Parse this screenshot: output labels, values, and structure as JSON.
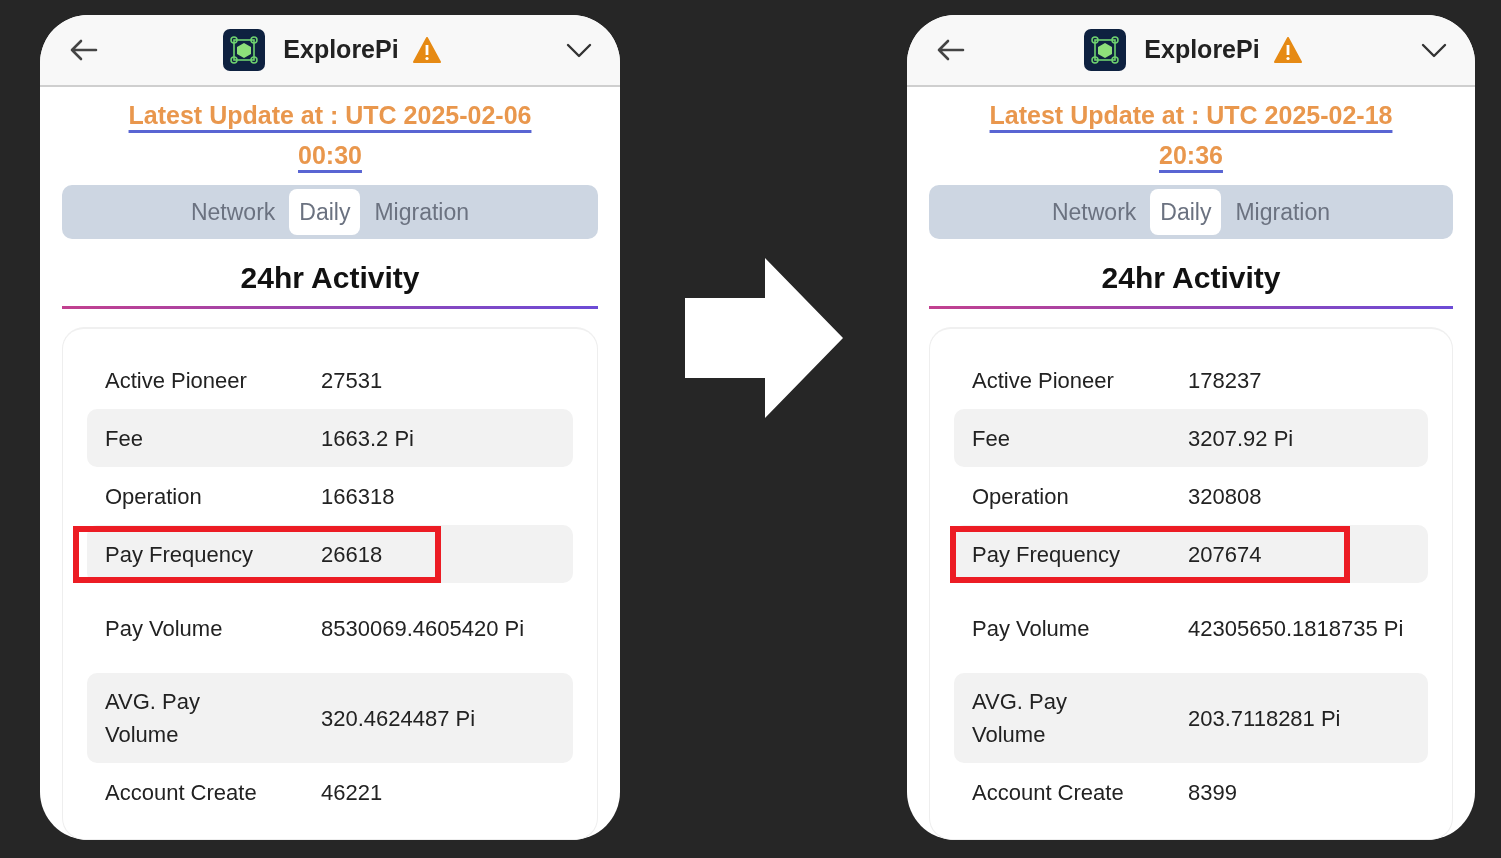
{
  "screens": [
    {
      "app_name": "ExplorePi",
      "update_text": "Latest Update at : UTC 2025-02-06 00:30",
      "tabs": [
        {
          "label": "Network",
          "selected": false
        },
        {
          "label": "Daily",
          "selected": true
        },
        {
          "label": "Migration",
          "selected": false
        }
      ],
      "heading": "24hr Activity",
      "rows": [
        {
          "label": "Active Pioneer",
          "value": "27531",
          "highlighted": false
        },
        {
          "label": "Fee",
          "value": "1663.2 Pi",
          "highlighted": false
        },
        {
          "label": "Operation",
          "value": "166318",
          "highlighted": false
        },
        {
          "label": "Pay Frequency",
          "value": "26618",
          "highlighted": true
        },
        {
          "label": "Pay Volume",
          "value": "8530069.4605420 Pi",
          "highlighted": false
        },
        {
          "label": "AVG. Pay Volume",
          "value": "320.4624487 Pi",
          "highlighted": false
        },
        {
          "label": "Account Create",
          "value": "46221",
          "highlighted": false
        }
      ]
    },
    {
      "app_name": "ExplorePi",
      "update_text": "Latest Update at : UTC 2025-02-18 20:36",
      "tabs": [
        {
          "label": "Network",
          "selected": false
        },
        {
          "label": "Daily",
          "selected": true
        },
        {
          "label": "Migration",
          "selected": false
        }
      ],
      "heading": "24hr Activity",
      "rows": [
        {
          "label": "Active Pioneer",
          "value": "178237",
          "highlighted": false
        },
        {
          "label": "Fee",
          "value": "3207.92 Pi",
          "highlighted": false
        },
        {
          "label": "Operation",
          "value": "320808",
          "highlighted": false
        },
        {
          "label": "Pay Frequency",
          "value": "207674",
          "highlighted": true
        },
        {
          "label": "Pay Volume",
          "value": "42305650.1818735 Pi",
          "highlighted": false
        },
        {
          "label": "AVG. Pay Volume",
          "value": "203.7118281 Pi",
          "highlighted": false
        },
        {
          "label": "Account Create",
          "value": "8399",
          "highlighted": false
        }
      ]
    }
  ]
}
